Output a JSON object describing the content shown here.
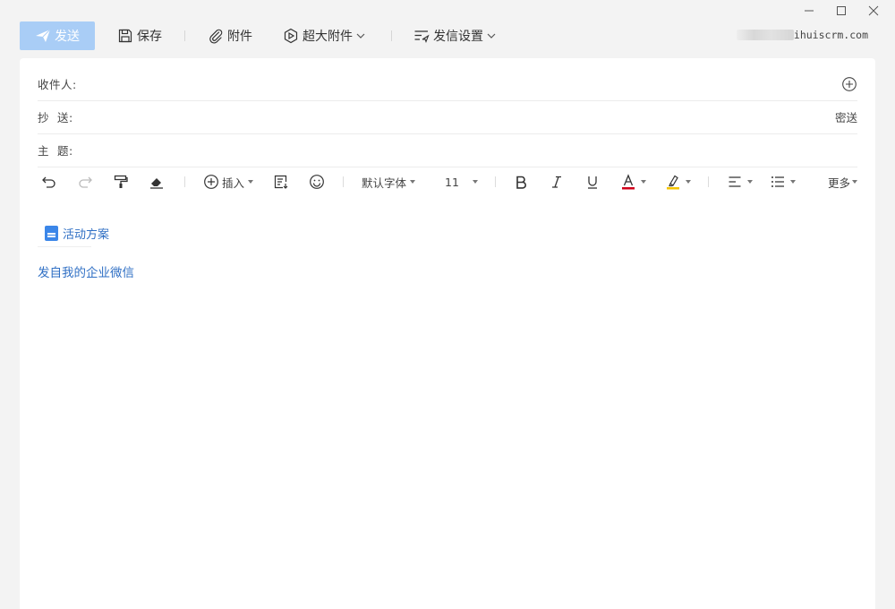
{
  "toolbar": {
    "send_label": "发送",
    "save_label": "保存",
    "attach_label": "附件",
    "big_attach_label": "超大附件",
    "send_settings_label": "发信设置",
    "account_suffix": "ihuiscrm.com"
  },
  "header": {
    "to_label": "收件人:",
    "cc_label": "抄  送:",
    "bcc_label": "密送",
    "subject_label": "主  题:"
  },
  "format": {
    "insert_label": "插入",
    "font_label": "默认字体",
    "font_size": "11",
    "more_label": "更多",
    "font_color": "#d0021b",
    "highlight_color": "#f5c400"
  },
  "body": {
    "attachment_name": "活动方案",
    "signature": "发自我的企业微信"
  },
  "colors": {
    "send_button": "#a9cdf6",
    "link": "#2f6fc4"
  }
}
